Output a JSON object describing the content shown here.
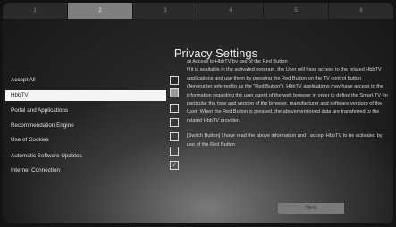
{
  "steps": [
    "1",
    "2",
    "3",
    "4",
    "5",
    "6"
  ],
  "active_step": "2",
  "title": "Privacy Settings",
  "menu": [
    {
      "label": "Accept All",
      "checked": false,
      "selected": false
    },
    {
      "label": "HbbTV",
      "checked": true,
      "selected": true
    },
    {
      "label": "Portal and Applications",
      "checked": false,
      "selected": false
    },
    {
      "label": "Recommendation Engine",
      "checked": false,
      "selected": false
    },
    {
      "label": "Use of Cookies",
      "checked": false,
      "selected": false
    },
    {
      "label": "Automatic Software Updates",
      "checked": false,
      "selected": false
    },
    {
      "label": "Internet Connection",
      "checked": true,
      "selected": false
    }
  ],
  "description": {
    "heading": "a) Access to HbbTV by use of the Red Button",
    "body": "If it is available in the activated program, the User will have access to the related HbbTV applications and use them by pressing the Red Button on the TV control button (hereinafter referred to as the \"Red Button\"). HbbTV applications may have access to the information regarding the user agent of the web browser in order to define the Smart TV (in particular the type and version of the browser, manufacturer and software version) of the User. When the Red Button is pressed, the abovementioned data are transferred to the related HbbTV provider.",
    "consent": "[Switch Button] I have read the above information and I accept HbbTV to be activated by use of the Red Button"
  },
  "next_label": "Next"
}
